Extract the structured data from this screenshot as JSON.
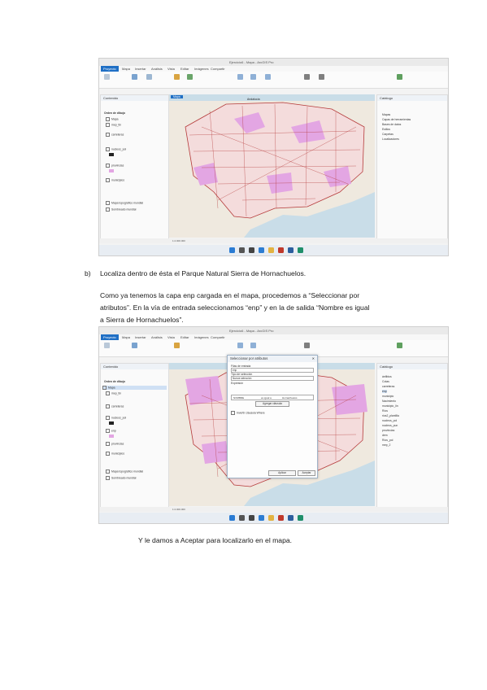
{
  "screenshot1": {
    "app_title": "Ejercicio6 - Mapa - ArcGIS Pro",
    "ribbon_tabs": [
      "Proyecto",
      "Mapa",
      "Insertar",
      "Análisis",
      "Vista",
      "Editar",
      "Imágenes",
      "Compartir"
    ],
    "contents_title": "Contenido",
    "catalog_title": "Catálogo",
    "drawing_order": "Orden de dibujo",
    "layers": [
      "Mapa",
      "mep_tin",
      "carreteras",
      "nucleos_pol",
      "provincias",
      "municipios",
      "Mapa topográfico mundial",
      "Sombreado mundial"
    ],
    "catalog_items": [
      "Mapas",
      "Capas de herramientas",
      "Bases de datos",
      "Estilos",
      "Carpetas",
      "Localizadores"
    ],
    "map_tab": "Mapa",
    "scale": "1:2.000.000",
    "map_label": "Andalucía"
  },
  "screenshot2": {
    "app_title": "Ejercicio6 - Mapa - ArcGIS Pro",
    "dialog_title": "Seleccionar por atributos",
    "input_rows_label": "Filas de entrada",
    "input_rows_value": "enp",
    "selection_type_label": "Tipo de selección",
    "selection_type_value": "Nueva selección",
    "expression_label": "Expresión",
    "where_field": "NOMBRE",
    "where_operator": "es igual a",
    "where_value": "Hornachuelos",
    "add_clause": "Agregar cláusula",
    "invert": "Invertir cláusula Where",
    "apply_button": "Aplicar",
    "ok_button": "Aceptar",
    "catalog_items": [
      "ánfibios",
      "Cotas",
      "carreteras",
      "enp",
      "municipio",
      "Nacimiento",
      "municipio_lin",
      "Ríos",
      "rios2_plantilla",
      "nucleos_pol",
      "nucleos_pun",
      "provincias",
      "dem",
      "Ríos_pol",
      "mep_2"
    ]
  },
  "text": {
    "item_label": "b)",
    "item_text": "Localiza dentro de ésta el Parque Natural Sierra de Hornachuelos.",
    "para_line1": "Como ya tenemos la capa enp cargada en el mapa, procedemos a “Seleccionar por",
    "para_line2": "atributos”. En la vía de entrada seleccionamos “enp” y en la de salida “Nombre es igual",
    "para_line3": "a Sierra de Hornachuelos”.",
    "closing": "Y le damos a Aceptar para localizarlo en el mapa."
  },
  "colors": {
    "accent": "#1f6fc5",
    "land": "#efe9df",
    "sea": "#c9dde8",
    "protected": "#e3a6e3",
    "roads": "#b53a3a"
  }
}
